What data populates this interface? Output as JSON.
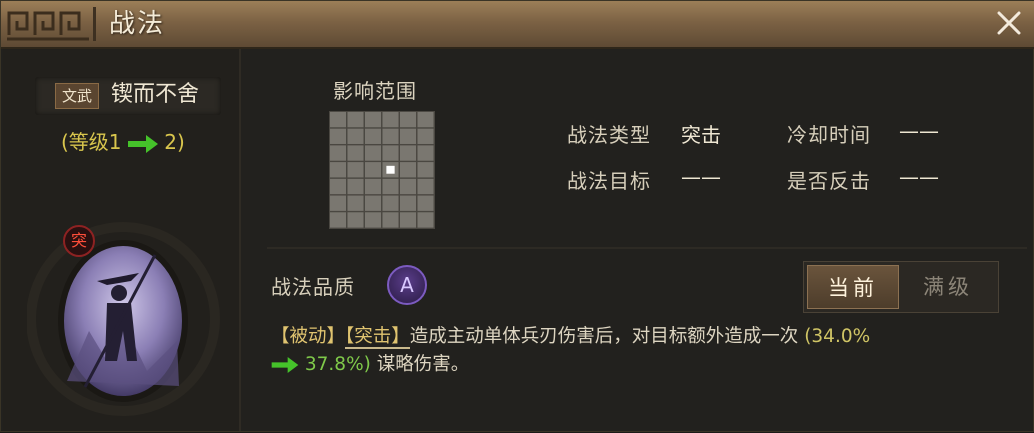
{
  "window": {
    "title": "战法",
    "close_label": ""
  },
  "skill": {
    "type_badge": "文武",
    "name": "锲而不舍",
    "level_prefix": "(等级1",
    "level_suffix": "2)",
    "tag": "突"
  },
  "influence": {
    "title": "影响范围",
    "grid_rows": 7,
    "grid_cols": 6,
    "highlight_row": 3,
    "highlight_col": 3
  },
  "info": {
    "type_label": "战法类型",
    "type_value": "突击",
    "cooldown_label": "冷却时间",
    "cooldown_value": "——",
    "target_label": "战法目标",
    "target_value": "——",
    "counter_label": "是否反击",
    "counter_value": "——"
  },
  "quality": {
    "label": "战法品质",
    "grade": "A"
  },
  "tabs": {
    "current": "当前",
    "max": "满级"
  },
  "description": {
    "tag1": "【被动】",
    "tag2": "【突击】",
    "text": "造成主动单体兵刃伤害后，对目标额外造成一次",
    "pct_from": "(34.0%",
    "pct_to": "37.8%)",
    "tail": "谋略伤害。"
  },
  "colors": {
    "accent_gold": "#e0c470",
    "arrow_green": "#45c22a",
    "grade_purple": "#7c5bc0",
    "tag_red": "#ff4e3a"
  }
}
